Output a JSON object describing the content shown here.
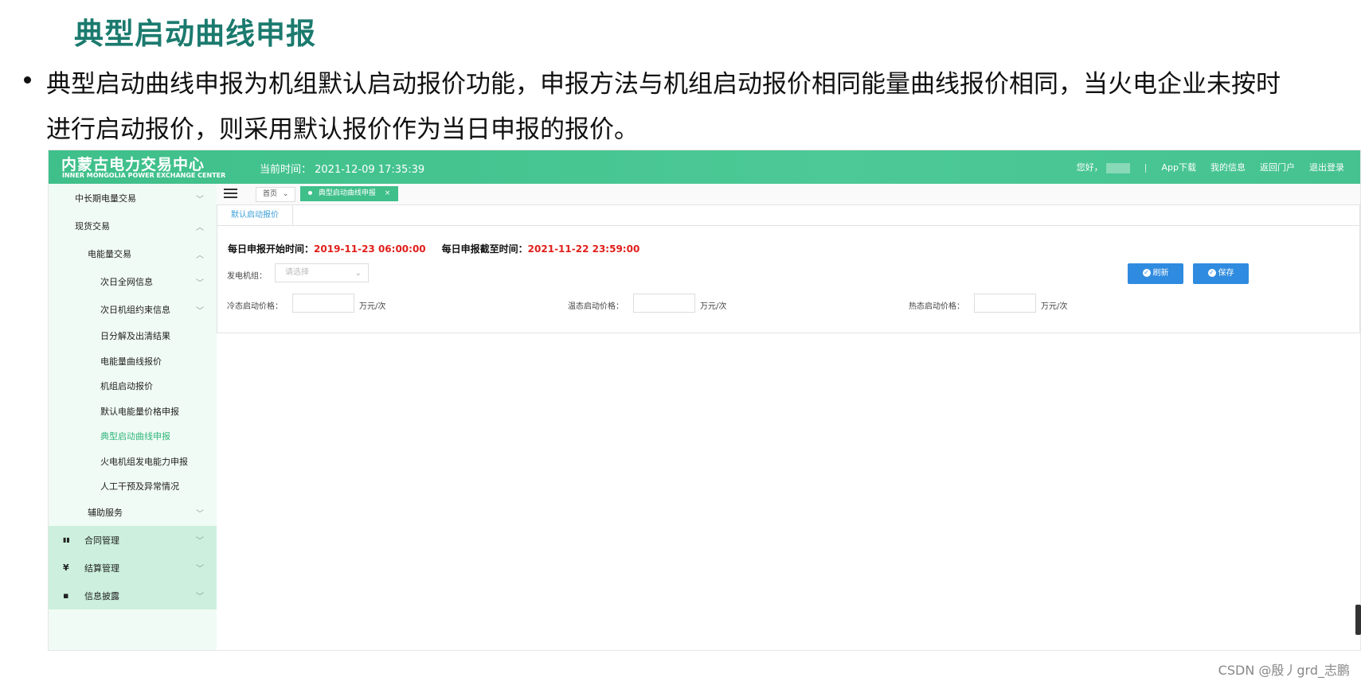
{
  "slide": {
    "title": "典型启动曲线申报",
    "bullet": "典型启动曲线申报为机组默认启动报价功能，申报方法与机组启动报价相同能量曲线报价相同，当火电企业未按时进行启动报价，则采用默认报价作为当日申报的报价。"
  },
  "app": {
    "logo_cn": "内蒙古电力交易中心",
    "logo_en": "INNER MONGOLIA POWER EXCHANGE CENTER",
    "current_time": "当前时间： 2021-12-09 17:35:39",
    "greeting": "您好，",
    "separator": "|",
    "nav": {
      "app_download": "App下载",
      "my_info": "我的信息",
      "back_portal": "返回门户",
      "logout": "退出登录"
    },
    "accent_color": "#3fbf8a"
  },
  "sidebar": {
    "items": [
      {
        "label": "中长期电量交易",
        "chevron": "﹀"
      },
      {
        "label": "现货交易",
        "chevron": "︿"
      },
      {
        "label": "电能量交易",
        "chevron": "︿"
      },
      {
        "label": "次日全网信息",
        "chevron": "﹀"
      },
      {
        "label": "次日机组约束信息",
        "chevron": "﹀"
      },
      {
        "label": "日分解及出清结果"
      },
      {
        "label": "电能量曲线报价"
      },
      {
        "label": "机组启动报价"
      },
      {
        "label": "默认电能量价格申报"
      },
      {
        "label": "典型启动曲线申报"
      },
      {
        "label": "火电机组发电能力申报"
      },
      {
        "label": "人工干预及异常情况"
      },
      {
        "label": "辅助服务",
        "chevron": "﹀"
      },
      {
        "label": "合同管理",
        "chevron": "﹀",
        "icon": "▮▮"
      },
      {
        "label": "结算管理",
        "chevron": "﹀",
        "icon": "¥"
      },
      {
        "label": "信息披露",
        "chevron": "﹀",
        "icon": "▪"
      }
    ]
  },
  "tabs": {
    "home": "首页",
    "home_chevron": "⌄",
    "current": "典型启动曲线申报",
    "close": "×"
  },
  "panel": {
    "subtab": "默认启动报价",
    "start_label": "每日申报开始时间：",
    "start_value": "2019-11-23 06:00:00",
    "end_label": "每日申报截至时间：",
    "end_value": "2021-11-22 23:59:00",
    "unit_label": "发电机组：",
    "unit_placeholder": "请选择",
    "unit_chevron": "⌄",
    "cold_label": "冷态启动价格：",
    "warm_label": "温态启动价格：",
    "hot_label": "热态启动价格：",
    "price_unit": "万元/次",
    "refresh": "刷新",
    "save": "保存",
    "check": "✓"
  },
  "watermark": "CSDN @殷丿grd_志鹏"
}
